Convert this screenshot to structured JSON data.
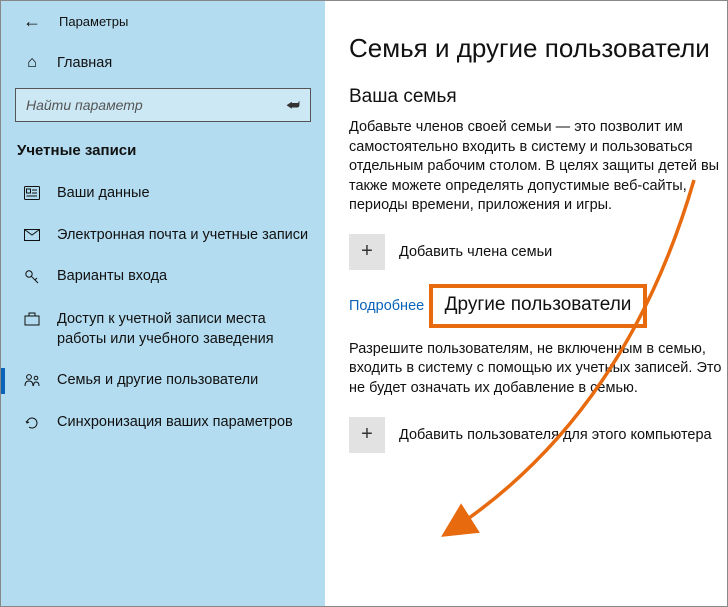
{
  "header": {
    "window_title": "Параметры"
  },
  "sidebar": {
    "home_label": "Главная",
    "search_placeholder": "Найти параметр",
    "category": "Учетные записи",
    "items": [
      {
        "label": "Ваши данные"
      },
      {
        "label": "Электронная почта и учетные записи"
      },
      {
        "label": "Варианты входа"
      },
      {
        "label": "Доступ к учетной записи места работы или учебного заведения"
      },
      {
        "label": "Семья и другие пользователи"
      },
      {
        "label": "Синхронизация ваших параметров"
      }
    ]
  },
  "content": {
    "page_title": "Семья и другие пользователи",
    "family_heading": "Ваша семья",
    "family_text": "Добавьте членов своей семьи — это позволит им самостоятельно входить в систему и пользоваться отдельным рабочим столом. В целях защиты детей вы также можете определять допустимые веб-сайты, периоды времени, приложения и игры.",
    "add_family_label": "Добавить члена семьи",
    "learn_more": "Подробнее",
    "others_heading": "Другие пользователи",
    "others_text": "Разрешите пользователям, не включенным в семью, входить в систему с помощью их учетных записей. Это не будет означать их добавление в семью.",
    "add_other_label": "Добавить пользователя для этого компьютера"
  }
}
